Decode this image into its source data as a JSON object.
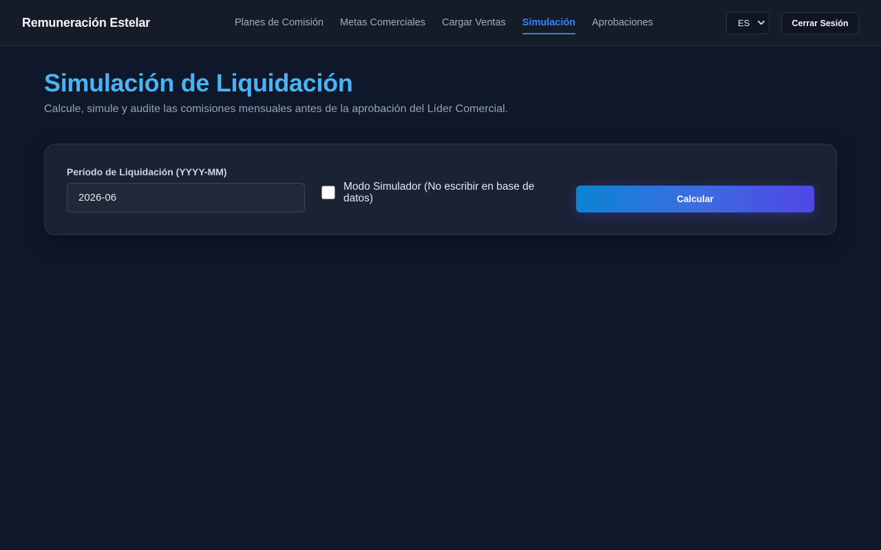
{
  "header": {
    "brand": "Remuneración Estelar",
    "nav": [
      {
        "label": "Planes de Comisión",
        "active": false
      },
      {
        "label": "Metas Comerciales",
        "active": false
      },
      {
        "label": "Cargar Ventas",
        "active": false
      },
      {
        "label": "Simulación",
        "active": true
      },
      {
        "label": "Aprobaciones",
        "active": false
      }
    ],
    "language": "ES",
    "logout_label": "Cerrar Sesión"
  },
  "main": {
    "title": "Simulación de Liquidación",
    "subtitle": "Calcule, simule y audite las comisiones mensuales antes de la aprobación del Líder Comercial.",
    "form": {
      "period_label": "Período de Liquidación (YYYY-MM)",
      "period_value": "2026-06",
      "simulator_checkbox_label": "Modo Simulador (No escribir en base de datos)",
      "simulator_checked": false,
      "calculate_label": "Calcular"
    }
  },
  "colors": {
    "background": "#0f172a",
    "accent": "#3b82f6",
    "title": "#4ab3f4",
    "button_gradient_start": "#0b84d4",
    "button_gradient_end": "#5046e5"
  }
}
